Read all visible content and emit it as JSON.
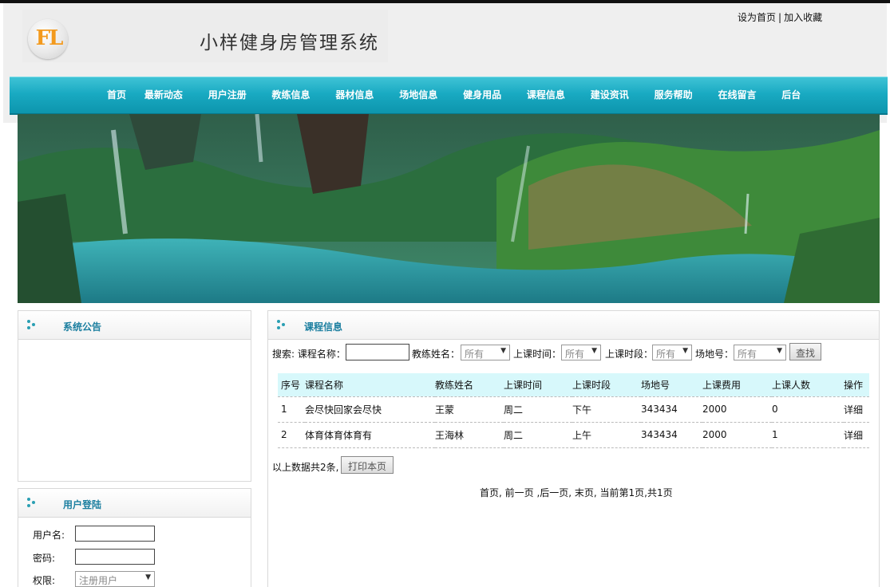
{
  "header": {
    "logo_text": "FL",
    "site_title": "小样健身房管理系统",
    "set_home": "设为首页",
    "separator": "|",
    "add_favorite": "加入收藏"
  },
  "nav": {
    "items": [
      "首页",
      "最新动态",
      "用户注册",
      "教练信息",
      "器材信息",
      "场地信息",
      "健身用品",
      "课程信息",
      "建设资讯",
      "服务帮助",
      "在线留言",
      "后台"
    ]
  },
  "notice_panel": {
    "title": "系统公告"
  },
  "login_panel": {
    "title": "用户登陆",
    "username_label": "用户名:",
    "password_label": "密码:",
    "role_label": "权限:",
    "role_selected": "注册用户"
  },
  "course_panel": {
    "title": "课程信息",
    "search": {
      "prefix": "搜索: 课程名称：",
      "coach_label": "教练姓名：",
      "coach_selected": "所有",
      "time_label": "上课时间：",
      "time_selected": "所有",
      "period_label": "上课时段：",
      "period_selected": "所有",
      "venue_label": "场地号：",
      "venue_selected": "所有",
      "search_button": "查找"
    },
    "table": {
      "headers": [
        "序号",
        "课程名称",
        "教练姓名",
        "上课时间",
        "上课时段",
        "场地号",
        "上课费用",
        "上课人数",
        "操作"
      ],
      "rows": [
        [
          "1",
          "会尽快回家会尽快",
          "王蒙",
          "周二",
          "下午",
          "343434",
          "2000",
          "0",
          "详细"
        ],
        [
          "2",
          "体育体育体育有",
          "王海林",
          "周二",
          "上午",
          "343434",
          "2000",
          "1",
          "详细"
        ]
      ]
    },
    "summary": "以上数据共2条,",
    "print_button": "打印本页",
    "pager": "首页, 前一页 ,后一页, 末页, 当前第1页,共1页"
  },
  "colors": {
    "nav_teal": "#19aac2",
    "table_header_bg": "#d7f8fb",
    "panel_title": "#1c7fa0",
    "logo_orange": "#f39a1e"
  }
}
